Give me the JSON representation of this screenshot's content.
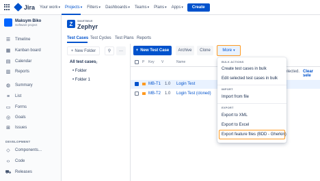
{
  "topnav": {
    "product": "Jira",
    "items": [
      {
        "label": "Your work"
      },
      {
        "label": "Projects"
      },
      {
        "label": "Filters"
      },
      {
        "label": "Dashboards"
      },
      {
        "label": "Teams"
      },
      {
        "label": "Plans"
      },
      {
        "label": "Apps"
      }
    ],
    "create_label": "Create"
  },
  "project": {
    "name": "Maksym Biko",
    "type": "Software project"
  },
  "sidebar": {
    "items": [
      {
        "label": "Timeline",
        "icon": "timeline-icon"
      },
      {
        "label": "Kanban board",
        "icon": "board-icon"
      },
      {
        "label": "Calendar",
        "icon": "calendar-icon"
      },
      {
        "label": "Reports",
        "icon": "reports-icon"
      },
      {
        "label": "Summary",
        "icon": "globe-icon"
      },
      {
        "label": "List",
        "icon": "list-icon"
      },
      {
        "label": "Forms",
        "icon": "forms-icon"
      },
      {
        "label": "Goals",
        "icon": "goals-icon"
      },
      {
        "label": "Issues",
        "icon": "issues-icon"
      }
    ],
    "section_development": "DEVELOPMENT",
    "dev_items": [
      {
        "label": "Components...",
        "icon": "components-icon"
      },
      {
        "label": "Code",
        "icon": "code-icon"
      },
      {
        "label": "Releases",
        "icon": "releases-icon"
      }
    ]
  },
  "app": {
    "kicker": "SMARTBEAR",
    "title": "Zephyr"
  },
  "tabs": [
    {
      "label": "Test Cases"
    },
    {
      "label": "Test Cycles"
    },
    {
      "label": "Test Plans"
    },
    {
      "label": "Reports"
    }
  ],
  "folder_panel": {
    "new_folder_label": "New Folder",
    "all_label": "All test cases",
    "count": "2",
    "folders": [
      "Folder",
      "Folder 1"
    ]
  },
  "toolbar": {
    "new_test_case": "New Test Case",
    "archive": "Archive",
    "clone": "Clone",
    "more": "More"
  },
  "table": {
    "columns": [
      "P",
      "Key",
      "V",
      "Name"
    ],
    "rows": [
      {
        "key": "MB-T1",
        "version": "1.0",
        "name": "Login Test",
        "selected": true
      },
      {
        "key": "MB-T2",
        "version": "1.0",
        "name": "Login Test (cloned)",
        "selected": false
      }
    ],
    "selection_text": "selected.",
    "clear_selection": "Clear sele"
  },
  "dropdown": {
    "section_bulk": "BULK ACTIONS",
    "create_bulk": "Create test cases in bulk",
    "edit_bulk": "Edit selected test cases in bulk",
    "section_import": "IMPORT",
    "import_file": "Import from file",
    "section_export": "EXPORT",
    "export_xml": "Export to XML",
    "export_excel": "Export to Excel",
    "export_feature": "Export feature files (BDD - Gherkin)"
  },
  "colors": {
    "brand": "#0052cc",
    "highlight": "#ff991f",
    "priority": "#ff991f"
  }
}
